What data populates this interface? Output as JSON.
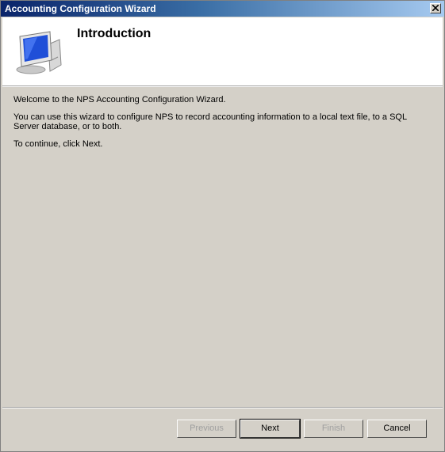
{
  "window": {
    "title": "Accounting Configuration Wizard",
    "close_icon": "close-icon"
  },
  "header": {
    "title": "Introduction",
    "icon": "computer-monitor-icon"
  },
  "body": {
    "line1": "Welcome to the NPS Accounting Configuration Wizard.",
    "line2": "You can use this wizard to configure NPS to record accounting information to a local text file, to a SQL Server database, or to both.",
    "line3": "To continue, click Next."
  },
  "buttons": {
    "previous": "Previous",
    "next": "Next",
    "finish": "Finish",
    "cancel": "Cancel"
  },
  "colors": {
    "titlebar_start": "#0a246a",
    "titlebar_end": "#a6caf0",
    "dialog_bg": "#d4d0c8",
    "header_bg": "#ffffff"
  }
}
